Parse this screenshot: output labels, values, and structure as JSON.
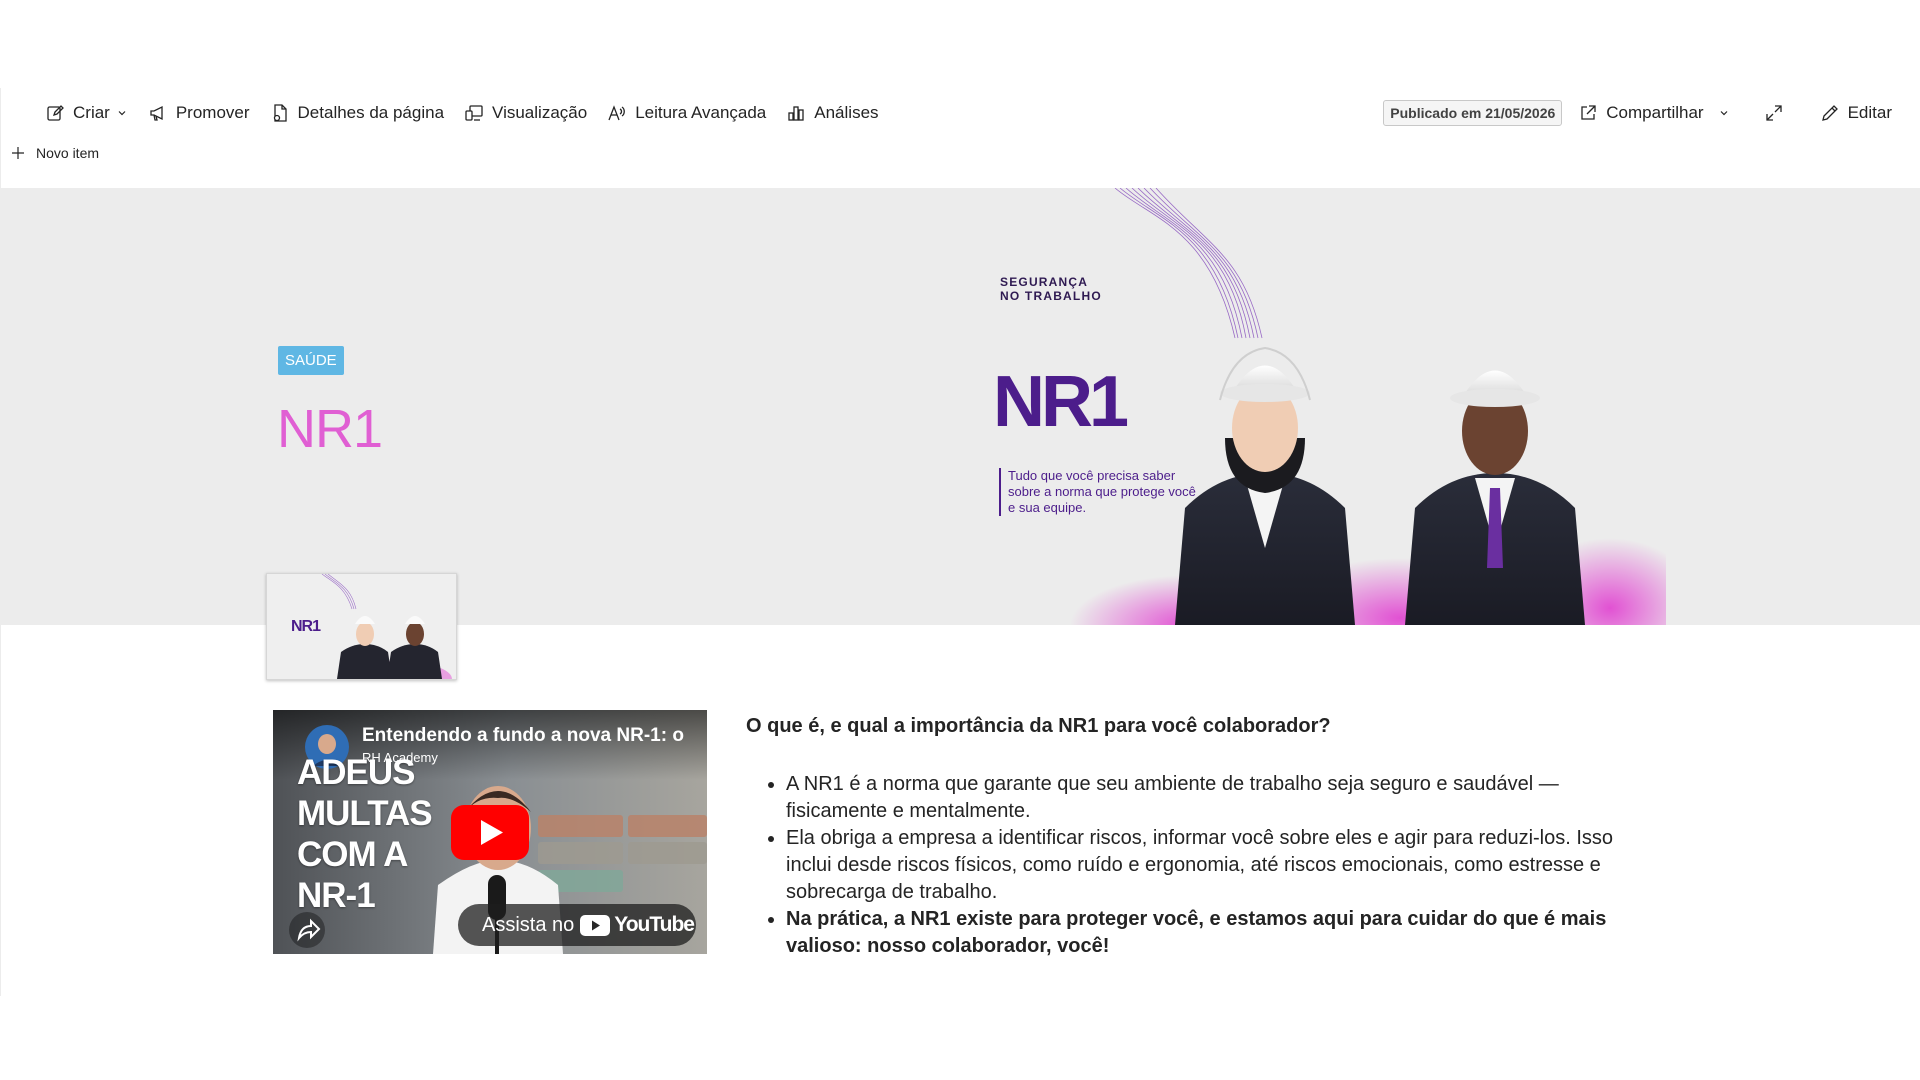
{
  "commandbar": {
    "left": [
      {
        "id": "criar",
        "label": "Criar",
        "icon": "edit-icon",
        "dropdown": true
      },
      {
        "id": "promover",
        "label": "Promover",
        "icon": "megaphone-icon",
        "dropdown": false
      },
      {
        "id": "detalhes",
        "label": "Detalhes da página",
        "icon": "page-settings-icon",
        "dropdown": false
      },
      {
        "id": "visualizacao",
        "label": "Visualização",
        "icon": "preview-icon",
        "dropdown": false
      },
      {
        "id": "leitura",
        "label": "Leitura Avançada",
        "icon": "immersive-reader-icon",
        "dropdown": false
      },
      {
        "id": "analises",
        "label": "Análises",
        "icon": "analytics-icon",
        "dropdown": false
      }
    ],
    "published": "Publicado em 21/05/2026",
    "share_label": "Compartilhar",
    "edit_label": "Editar"
  },
  "new_item": "Novo item",
  "hero": {
    "tag": "SAÚDE",
    "title": "NR1",
    "banner": {
      "kicker_line1": "SEGURANÇA",
      "kicker_line2": "NO TRABALHO",
      "headline": "NR1",
      "subtitle": "Tudo que você precisa saber sobre a norma que protege você e sua equipe."
    },
    "thumbnail_headline": "NR1"
  },
  "video": {
    "title": "Entendendo a fundo a nova NR-1: o",
    "channel": "RH Academy",
    "thumb_lines": [
      "ADEUS",
      "MULTAS",
      "COM A",
      "NR-1"
    ],
    "watch_label": "Assista no",
    "yt_label": "YouTube"
  },
  "article": {
    "heading": "O que é, e qual a importância da NR1 para você colaborador?",
    "bullets": [
      "A NR1 é a norma que garante que seu ambiente de trabalho seja seguro e saudável — fisicamente e mentalmente.",
      "Ela obriga a empresa a identificar riscos, informar você sobre eles e agir para reduzi-los. Isso inclui desde riscos físicos, como ruído e ergonomia, até riscos emocionais, como estresse e sobrecarga de trabalho.",
      "Na prática, a NR1 existe para proteger você, e estamos aqui para cuidar do que é mais valioso: nosso colaborador, você!"
    ]
  },
  "colors": {
    "accent_pink": "#e05fd3",
    "tag_blue": "#5fb7e4",
    "brand_purple": "#4c1d8b",
    "youtube_red": "#ff0000"
  }
}
